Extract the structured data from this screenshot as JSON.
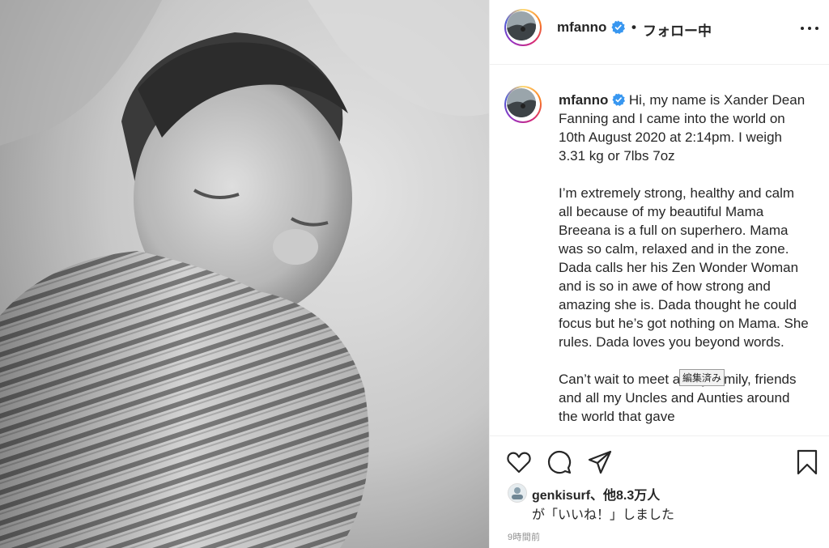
{
  "post": {
    "image_alt": "Black and white photo of a sleeping newborn swaddled in a striped blanket"
  },
  "header": {
    "username": "mfanno",
    "separator": "•",
    "follow_status": "フォロー中",
    "more_icon": "more-horizontal-icon"
  },
  "caption": {
    "username": "mfanno",
    "paragraphs": [
      "Hi, my name is Xander Dean Fanning and I came into the world on 10th August 2020 at 2:14pm. I weigh 3.31 kg or 7lbs 7oz",
      "I’m extremely strong, healthy and calm all because of my beautiful Mama Breeana is a full on superhero. Mama was so calm, relaxed and in the zone. Dada calls her his Zen Wonder Woman and is so in awe of how strong and amazing she is. Dada thought he could focus but he’s got nothing on Mama. She rules. Dada loves you beyond words.",
      "Can’t wait to meet all my family, friends and all my Uncles and Aunties around the world that gave"
    ],
    "tooltip": "編集済み"
  },
  "actions": {
    "icons": [
      "heart-icon",
      "comment-icon",
      "share-icon",
      "bookmark-icon"
    ]
  },
  "likes": {
    "line1": "genkisurf、他8.3万人",
    "line2": "が「いいね！」しました"
  },
  "timestamp": "9時間前",
  "colors": {
    "verified_blue": "#3897f0",
    "text": "#262626",
    "muted": "#8e8e8e",
    "divider": "#efefef"
  }
}
